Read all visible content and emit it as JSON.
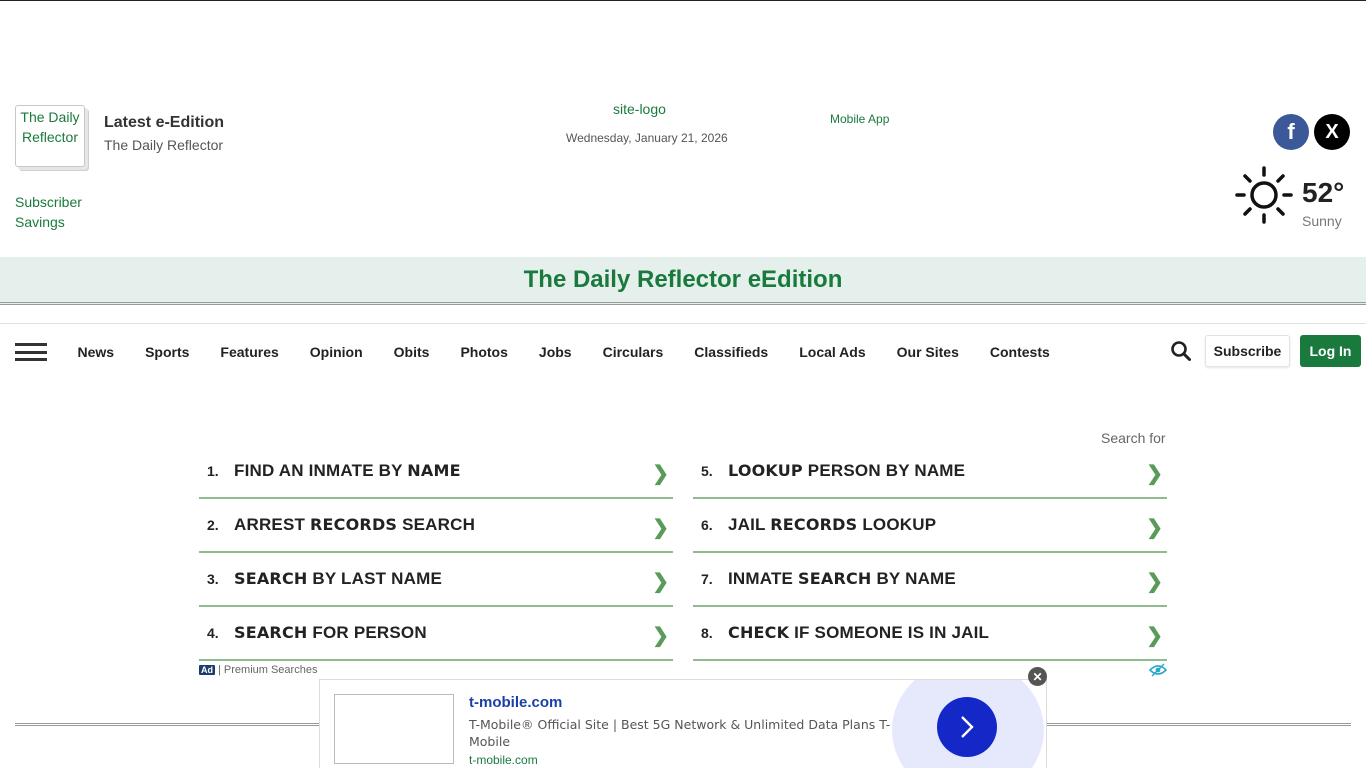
{
  "header": {
    "eedition_thumb_alt": "The Daily Reflector",
    "eedition_title": "Latest e-Edition",
    "eedition_subtitle": "The Daily Reflector",
    "subscriber_savings_alt": "Subscriber Savings",
    "site_logo_alt": "site-logo",
    "date": "Wednesday, January 21, 2026",
    "mobile_app": "Mobile App",
    "social": {
      "facebook": "f",
      "x": "X"
    },
    "weather": {
      "icon": "sun-icon",
      "temp": "52°",
      "condition": "Sunny"
    }
  },
  "banner": {
    "title": "The Daily Reflector eEdition"
  },
  "nav": {
    "items": [
      "News",
      "Sports",
      "Features",
      "Opinion",
      "Obits",
      "Photos",
      "Jobs",
      "Circulars",
      "Classifieds",
      "Local Ads",
      "Our Sites",
      "Contests"
    ],
    "subscribe": "Subscribe",
    "login": "Log In"
  },
  "search_ad": {
    "search_for": "Search for",
    "left": [
      {
        "num": "1.",
        "pre": "FIND AN INMATE BY ",
        "bold": "NAME",
        "post": ""
      },
      {
        "num": "2.",
        "pre": "ARREST ",
        "bold": "RECORDS",
        "post": " SEARCH"
      },
      {
        "num": "3.",
        "pre": "",
        "bold": "SEARCH",
        "post": " BY LAST NAME"
      },
      {
        "num": "4.",
        "pre": "",
        "bold": "SEARCH",
        "post": " FOR PERSON"
      }
    ],
    "right": [
      {
        "num": "5.",
        "pre": "",
        "bold": "LOOKUP",
        "post": " PERSON BY NAME"
      },
      {
        "num": "6.",
        "pre": "JAIL ",
        "bold": "RECORDS",
        "post": " LOOKUP"
      },
      {
        "num": "7.",
        "pre": "INMATE ",
        "bold": "SEARCH",
        "post": " BY NAME"
      },
      {
        "num": "8.",
        "pre": "",
        "bold": "CHECK",
        "post": " IF SOMEONE IS IN JAIL"
      }
    ],
    "ad_badge": "Ad",
    "footer": "| Premium Searches"
  },
  "sticky_ad": {
    "title": "t-mobile.com",
    "description": "T-Mobile® Official Site | Best 5G Network & Unlimited Data Plans T-Mobile",
    "url": "t-mobile.com",
    "close": "✕"
  },
  "colors": {
    "brand_green": "#1a7a3e",
    "banner_bg": "#e5f0ec",
    "ad_blue": "#1428c8"
  }
}
